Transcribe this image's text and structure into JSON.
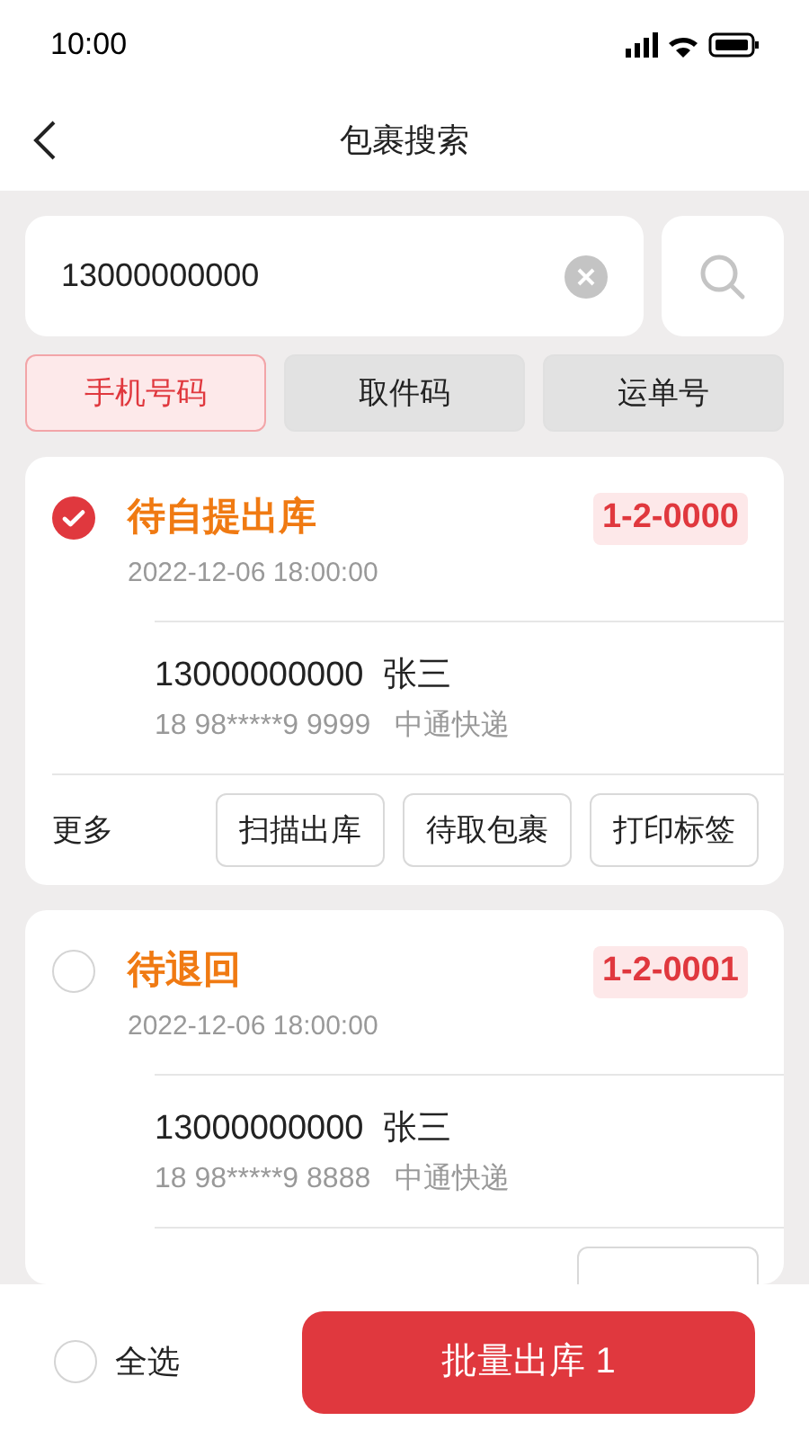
{
  "status_bar": {
    "time": "10:00"
  },
  "header": {
    "title": "包裹搜索"
  },
  "search": {
    "value": "13000000000"
  },
  "filter_tabs": [
    {
      "label": "手机号码",
      "selected": true
    },
    {
      "label": "取件码",
      "selected": false
    },
    {
      "label": "运单号",
      "selected": false
    }
  ],
  "parcels": [
    {
      "checked": true,
      "status": "待自提出库",
      "code": "1-2-0000",
      "time": "2022-12-06 18:00:00",
      "phone": "13000000000",
      "name": "张三",
      "tracking": "18 98*****9 9999",
      "carrier": "中通快递",
      "more": "更多",
      "actions": [
        "扫描出库",
        "待取包裹",
        "打印标签"
      ]
    },
    {
      "checked": false,
      "status": "待退回",
      "code": "1-2-0001",
      "time": "2022-12-06 18:00:00",
      "phone": "13000000000",
      "name": "张三",
      "tracking": "18 98*****9 8888",
      "carrier": "中通快递",
      "actions_cut": true
    }
  ],
  "bottom_bar": {
    "select_all": {
      "label": "全选",
      "checked": false
    },
    "button": "批量出库 1"
  }
}
